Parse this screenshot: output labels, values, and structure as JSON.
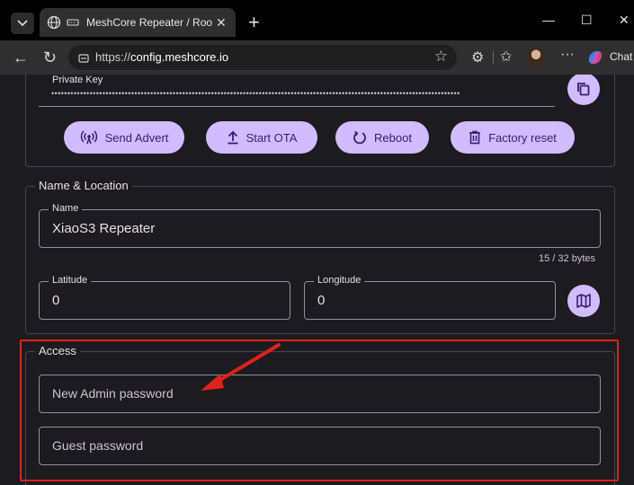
{
  "browser": {
    "tab_title": "MeshCore Repeater / Room s",
    "url_scheme": "https://",
    "url_host": "config.meshcore.io",
    "chat_label": "Chat"
  },
  "device": {
    "private_key_label": "Private Key",
    "private_key_value": "••••••••••••••••••••••••••••••••••••••••••••••••••••••••••••••••••••••••••••••••••••••••••••••••••••••••••••••••••••••••••••••••",
    "actions": {
      "send_advert": "Send Advert",
      "start_ota": "Start OTA",
      "reboot": "Reboot",
      "factory_reset": "Factory reset"
    }
  },
  "name_location": {
    "title": "Name & Location",
    "name_label": "Name",
    "name_value": "XiaoS3 Repeater",
    "name_counter": "15 / 32 bytes",
    "latitude_label": "Latitude",
    "latitude_value": "0",
    "longitude_label": "Longitude",
    "longitude_value": "0"
  },
  "access": {
    "title": "Access",
    "admin_password_placeholder": "New Admin password",
    "guest_password_placeholder": "Guest password"
  },
  "colors": {
    "accent": "#d0bcff",
    "on_accent": "#381e72",
    "surface": "#1c1b1f",
    "annotation": "#e0211a"
  }
}
